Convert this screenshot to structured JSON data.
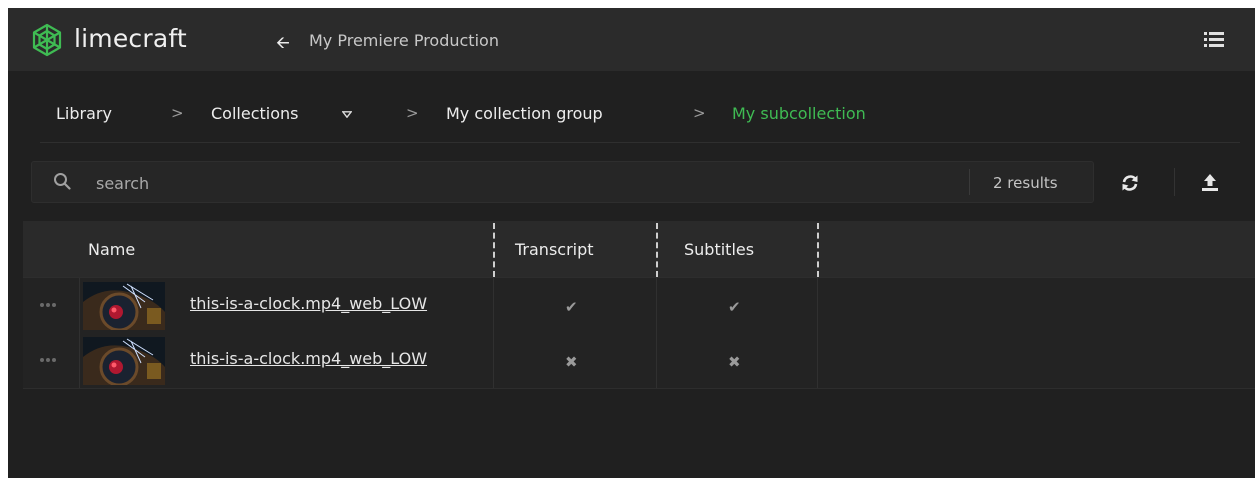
{
  "topbar": {
    "logo_text": "limecraft",
    "back_icon": "arrow-left-icon",
    "project_title": "My Premiere Production",
    "menu_icon": "list-view-icon"
  },
  "breadcrumb": {
    "items": [
      {
        "label": "Library"
      },
      {
        "label": "Collections"
      },
      {
        "label": "My collection group"
      },
      {
        "label": "My subcollection"
      }
    ],
    "separator": ">"
  },
  "search": {
    "placeholder": "search",
    "value": "",
    "results": "2 results"
  },
  "table": {
    "columns": [
      "Name",
      "Transcript",
      "Subtitles"
    ],
    "rows": [
      {
        "name": "this-is-a-clock.mp4_web_LOW",
        "transcript": "✔",
        "subtitles": "✔"
      },
      {
        "name": "this-is-a-clock.mp4_web_LOW",
        "transcript": "✖",
        "subtitles": "✖"
      }
    ]
  },
  "colors": {
    "accent": "#3fbb53",
    "background": "#202020",
    "topbar": "#2b2b2b"
  }
}
